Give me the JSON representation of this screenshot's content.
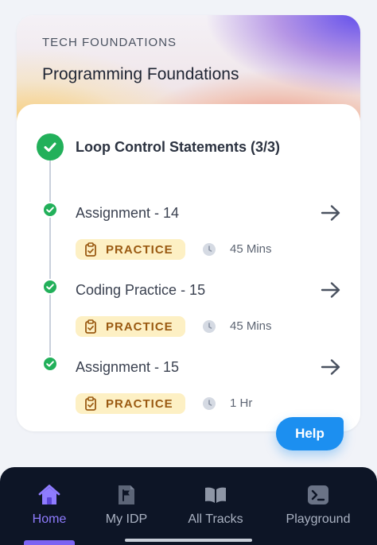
{
  "course": {
    "category": "TECH FOUNDATIONS",
    "title": "Programming Foundations"
  },
  "section": {
    "title": "Loop Control Statements (3/3)",
    "status": "completed"
  },
  "items": [
    {
      "title": "Assignment - 14",
      "badge": "PRACTICE",
      "duration": "45 Mins",
      "status": "completed"
    },
    {
      "title": "Coding Practice - 15",
      "badge": "PRACTICE",
      "duration": "45 Mins",
      "status": "completed"
    },
    {
      "title": "Assignment - 15",
      "badge": "PRACTICE",
      "duration": "1 Hr",
      "status": "completed"
    }
  ],
  "help": {
    "label": "Help"
  },
  "nav": {
    "active": "Home",
    "items": [
      {
        "label": "Home",
        "icon": "home-icon"
      },
      {
        "label": "My IDP",
        "icon": "flag-document-icon"
      },
      {
        "label": "All Tracks",
        "icon": "open-book-icon"
      },
      {
        "label": "Playground",
        "icon": "terminal-icon"
      }
    ]
  },
  "colors": {
    "success": "#22b05a",
    "badge_bg": "#fdf0c4",
    "badge_text": "#9a5a12",
    "help_button": "#1c8ff0",
    "nav_bg": "#0d1526",
    "nav_active": "#8f7cff"
  }
}
